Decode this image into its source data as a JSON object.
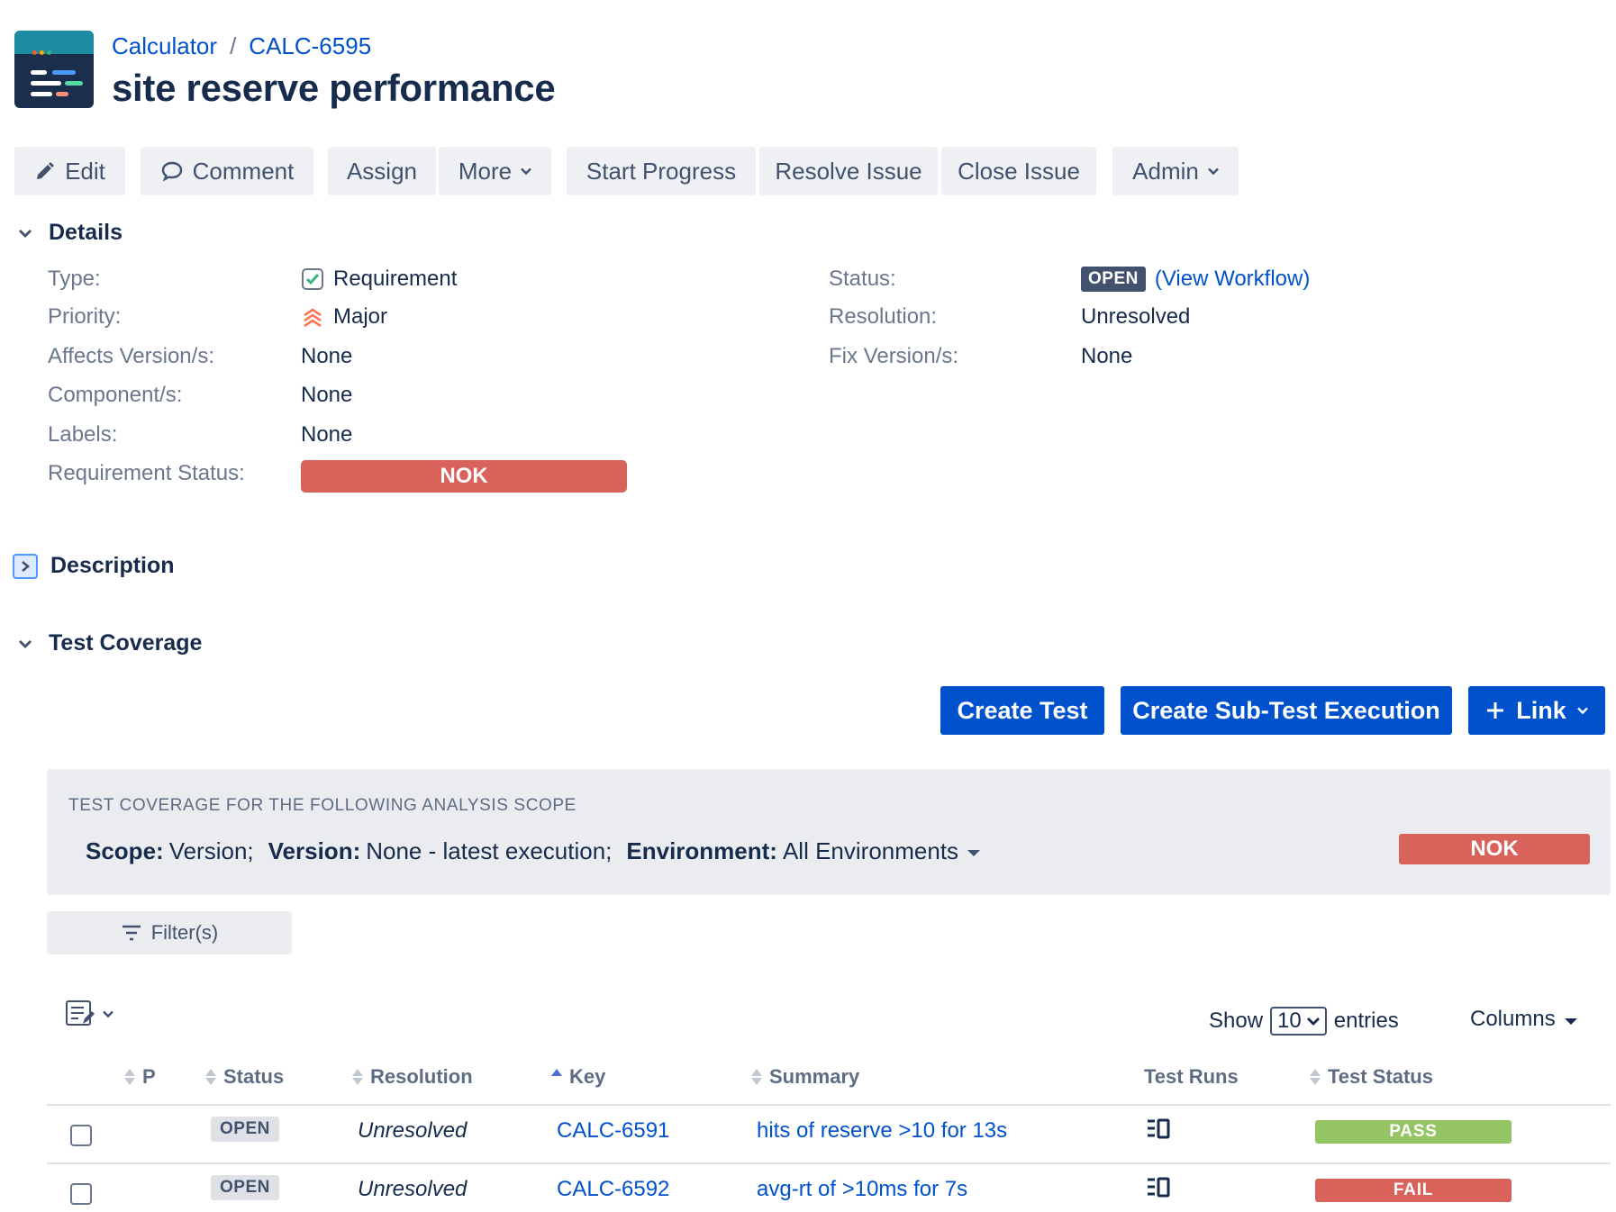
{
  "header": {
    "project": "Calculator",
    "separator": "/",
    "issue_key": "CALC-6595",
    "title": "site reserve performance"
  },
  "toolbar": {
    "edit": "Edit",
    "comment": "Comment",
    "assign": "Assign",
    "more": "More",
    "start_progress": "Start Progress",
    "resolve_issue": "Resolve Issue",
    "close_issue": "Close Issue",
    "admin": "Admin"
  },
  "details": {
    "heading": "Details",
    "type_label": "Type:",
    "type_value": "Requirement",
    "priority_label": "Priority:",
    "priority_value": "Major",
    "affects_label": "Affects Version/s:",
    "affects_value": "None",
    "component_label": "Component/s:",
    "component_value": "None",
    "labels_label": "Labels:",
    "labels_value": "None",
    "req_status_label": "Requirement Status:",
    "req_status_value": "NOK",
    "status_label": "Status:",
    "status_value": "OPEN",
    "workflow_open": "(",
    "workflow_link": "View Workflow",
    "workflow_close": ")",
    "resolution_label": "Resolution:",
    "resolution_value": "Unresolved",
    "fix_label": "Fix Version/s:",
    "fix_value": "None"
  },
  "description": {
    "heading": "Description"
  },
  "coverage": {
    "heading": "Test Coverage",
    "create_test": "Create Test",
    "create_sub": "Create Sub-Test Execution",
    "link": "Link",
    "scope_title": "TEST COVERAGE FOR THE FOLLOWING ANALYSIS SCOPE",
    "scope_label": "Scope:",
    "scope_value": "Version;",
    "version_label": "Version:",
    "version_value": "None - latest execution;",
    "env_label": "Environment:",
    "env_value": "All Environments",
    "status": "NOK",
    "filters": "Filter(s)",
    "show": "Show",
    "entries_value": "10",
    "entries": "entries",
    "columns": "Columns"
  },
  "table": {
    "headers": [
      "P",
      "Status",
      "Resolution",
      "Key",
      "Summary",
      "Test Runs",
      "Test Status"
    ],
    "rows": [
      {
        "status": "OPEN",
        "resolution": "Unresolved",
        "key": "CALC-6591",
        "summary": "hits of reserve >10 for 13s",
        "test_status": "PASS"
      },
      {
        "status": "OPEN",
        "resolution": "Unresolved",
        "key": "CALC-6592",
        "summary": "avg-rt of >10ms for 7s",
        "test_status": "FAIL"
      }
    ]
  },
  "colors": {
    "link": "#0052cc",
    "nok": "#d9625a",
    "pass": "#94c463",
    "fail": "#d9625a",
    "primary": "#0052cc"
  }
}
